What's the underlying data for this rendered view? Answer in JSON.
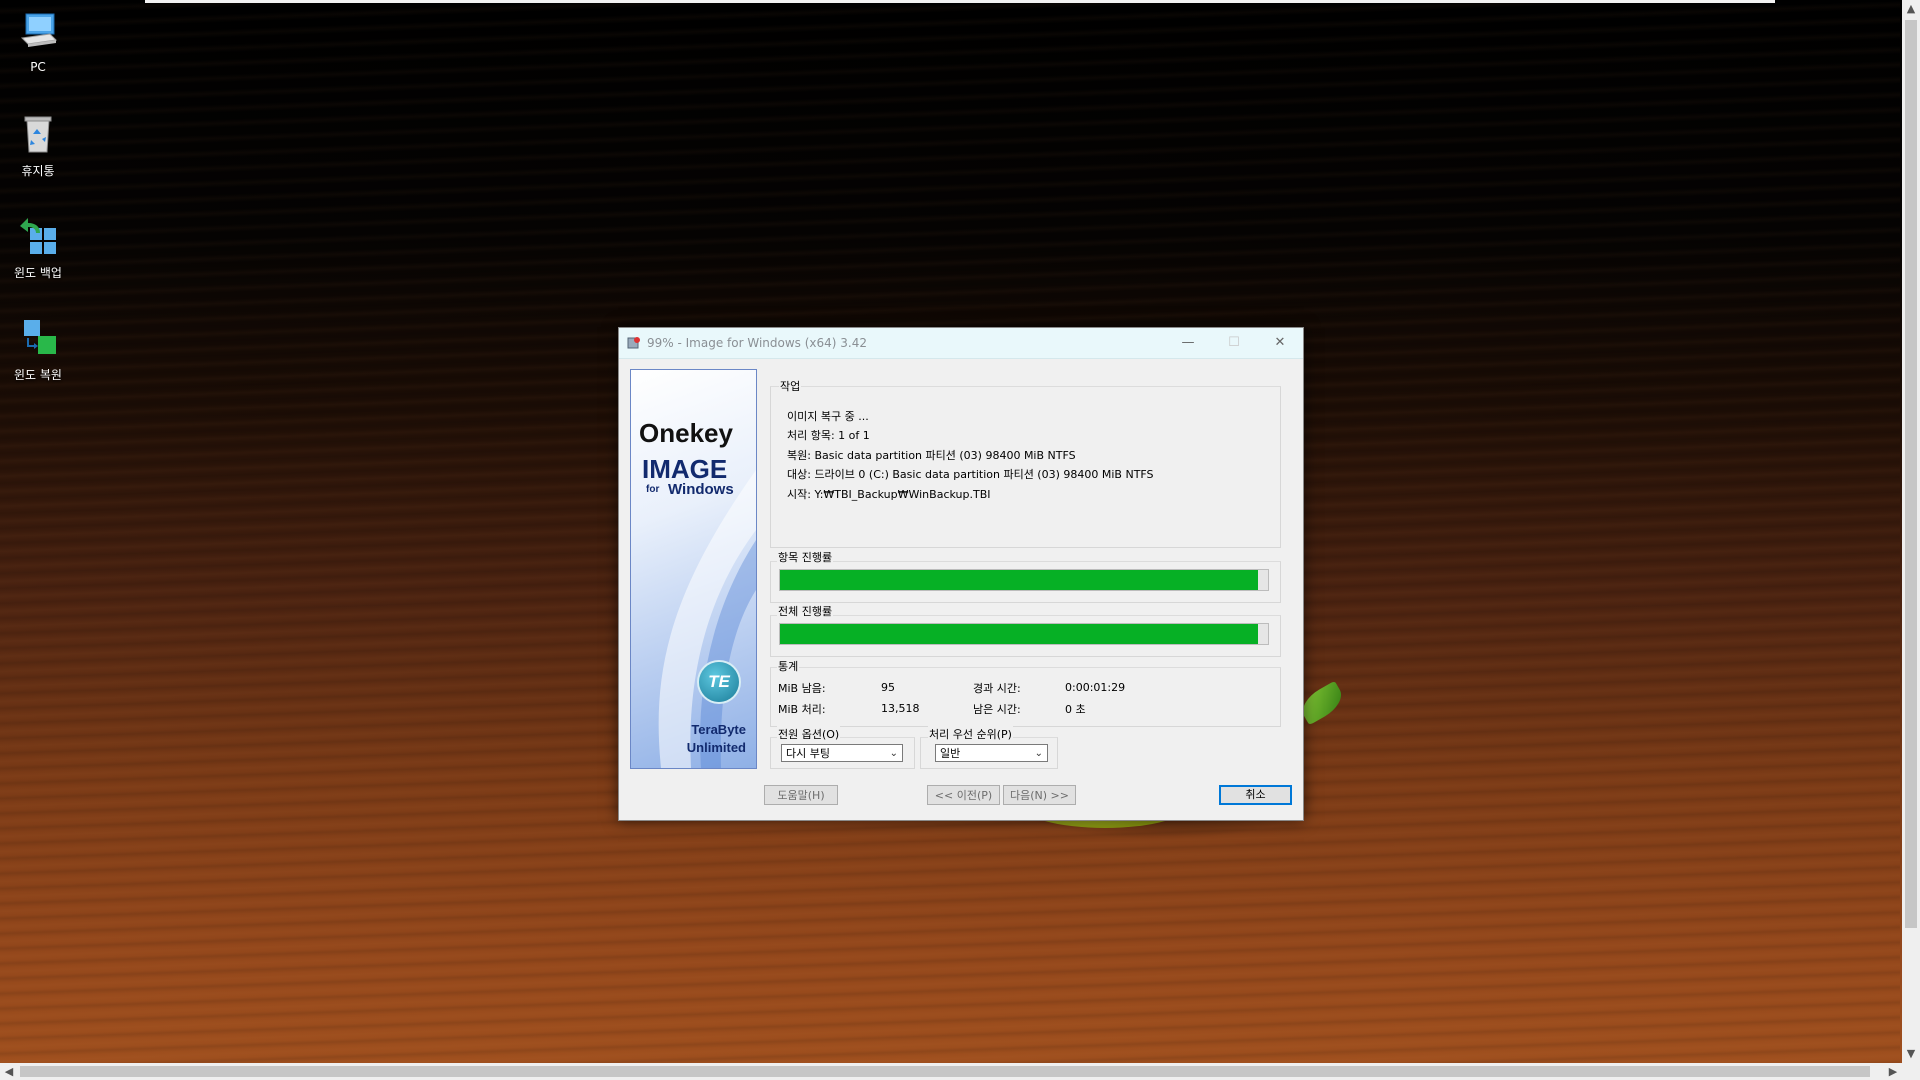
{
  "desktop": {
    "icons": [
      {
        "label": "PC"
      },
      {
        "label": "휴지통"
      },
      {
        "label": "윈도 백업"
      },
      {
        "label": "윈도 복원"
      }
    ]
  },
  "dialog": {
    "title": "99% - Image for Windows (x64) 3.42",
    "title_buttons": {
      "minimize": "—",
      "maximize": "☐",
      "close": "✕"
    },
    "banner": {
      "line1": "Onekey",
      "line2": "IMAGE",
      "line3_small": "for",
      "line3_large": "Windows",
      "logo_text": "TE",
      "vendor_line1": "TeraByte",
      "vendor_line2": "Unlimited"
    },
    "task": {
      "label": "작업",
      "lines": [
        "이미지 복구 중 ...",
        "처리 항목: 1 of 1",
        "복원: Basic data partition 파티션 (03) 98400 MiB NTFS",
        "대상: 드라이브 0 (C:) Basic data partition 파티션 (03) 98400 MiB NTFS",
        "시작: Y:₩TBI_Backup₩WinBackup.TBI"
      ]
    },
    "item_progress": {
      "label": "항목 진행률",
      "percent": 98
    },
    "total_progress": {
      "label": "전체 진행률",
      "percent": 98
    },
    "stats": {
      "label": "통계",
      "mib_remaining_label": "MiB 남음:",
      "mib_remaining": "95",
      "mib_processed_label": "MiB 처리:",
      "mib_processed": "13,518",
      "elapsed_label": "경과 시간:",
      "elapsed": "0:00:01:29",
      "remaining_label": "남은 시간:",
      "remaining": "0 초"
    },
    "power_option": {
      "label": "전원 옵션(O)",
      "value": "다시 부팅"
    },
    "priority": {
      "label": "처리 우선 순위(P)",
      "value": "일반"
    },
    "buttons": {
      "help": "도움말(H)",
      "prev": "<< 이전(P)",
      "next": "다음(N) >>",
      "cancel": "취소"
    }
  },
  "colors": {
    "progress_fill": "#06b025",
    "titlebar_bg": "#e9f8fb",
    "focus_border": "#0078d7"
  }
}
